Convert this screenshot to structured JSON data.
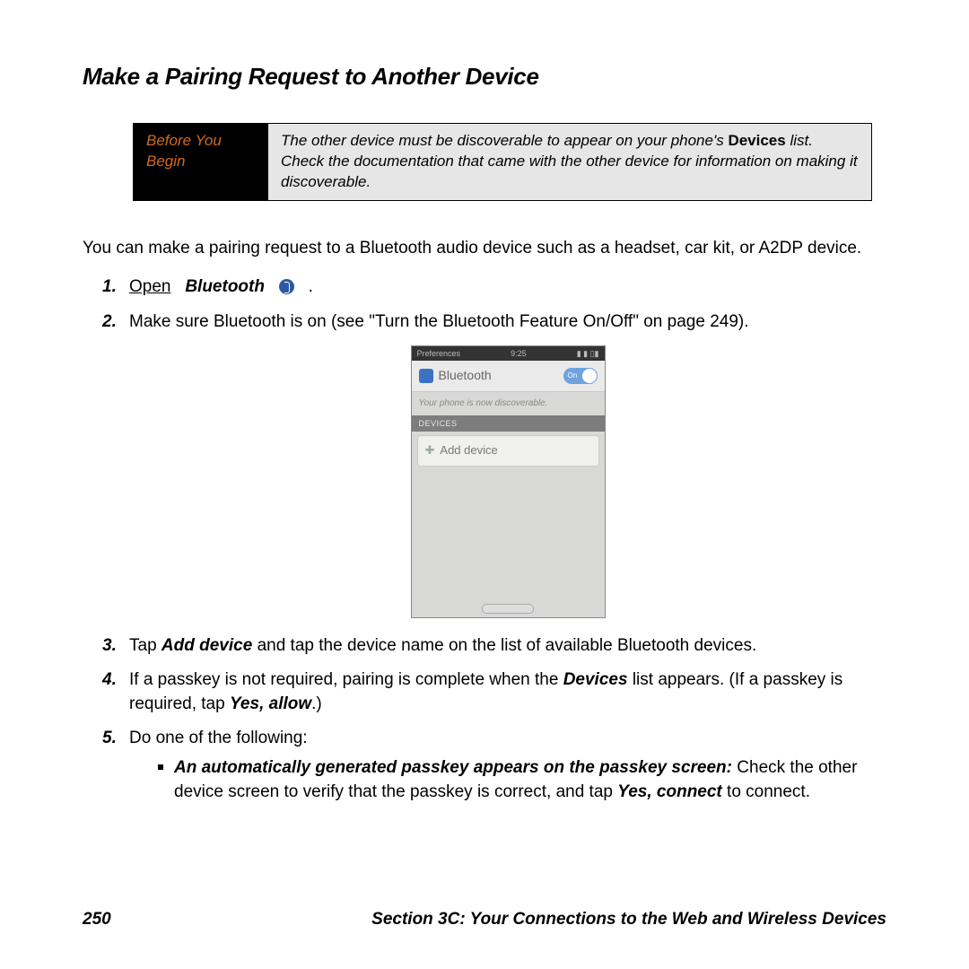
{
  "title": "Make a Pairing Request to Another Device",
  "before_box": {
    "label": "Before You Begin",
    "text_pre": "The other device must be discoverable to appear on your phone's ",
    "text_bold": "Devices",
    "text_post": " list. Check the documentation that came with the other device for information on making it discoverable."
  },
  "intro": "You can make a pairing request to a Bluetooth audio device such as a headset, car kit, or A2DP device.",
  "steps": {
    "s1_num": "1.",
    "s1_open": "Open",
    "s1_bt": "Bluetooth",
    "s1_dot": ".",
    "s2_num": "2.",
    "s2_text": "Make sure Bluetooth is on (see \"Turn the Bluetooth Feature On/Off\" on page 249).",
    "s3_num": "3.",
    "s3_pre": "Tap ",
    "s3_bold": "Add device",
    "s3_post": " and tap the device name on the list of available Bluetooth devices.",
    "s4_num": "4.",
    "s4_pre": "If a passkey is not required, pairing is complete when the ",
    "s4_b1": "Devices",
    "s4_mid": " list appears. (If a passkey is required, tap ",
    "s4_b2": "Yes, allow",
    "s4_post": ".)",
    "s5_num": "5.",
    "s5_text": "Do one of the following:",
    "s5a_lead": "An automatically generated passkey appears on the passkey screen:",
    "s5a_pre": " Check the other device screen to verify that the passkey is correct, and tap ",
    "s5a_bold": "Yes, connect",
    "s5a_post": " to connect."
  },
  "screenshot": {
    "menu": "Preferences",
    "time": "9:25",
    "header": "Bluetooth",
    "toggle": "On",
    "note": "Your phone is now discoverable.",
    "devhdr": "DEVICES",
    "add": "Add device"
  },
  "footer": {
    "page": "250",
    "section": "Section 3C: Your Connections to the Web and Wireless Devices"
  }
}
